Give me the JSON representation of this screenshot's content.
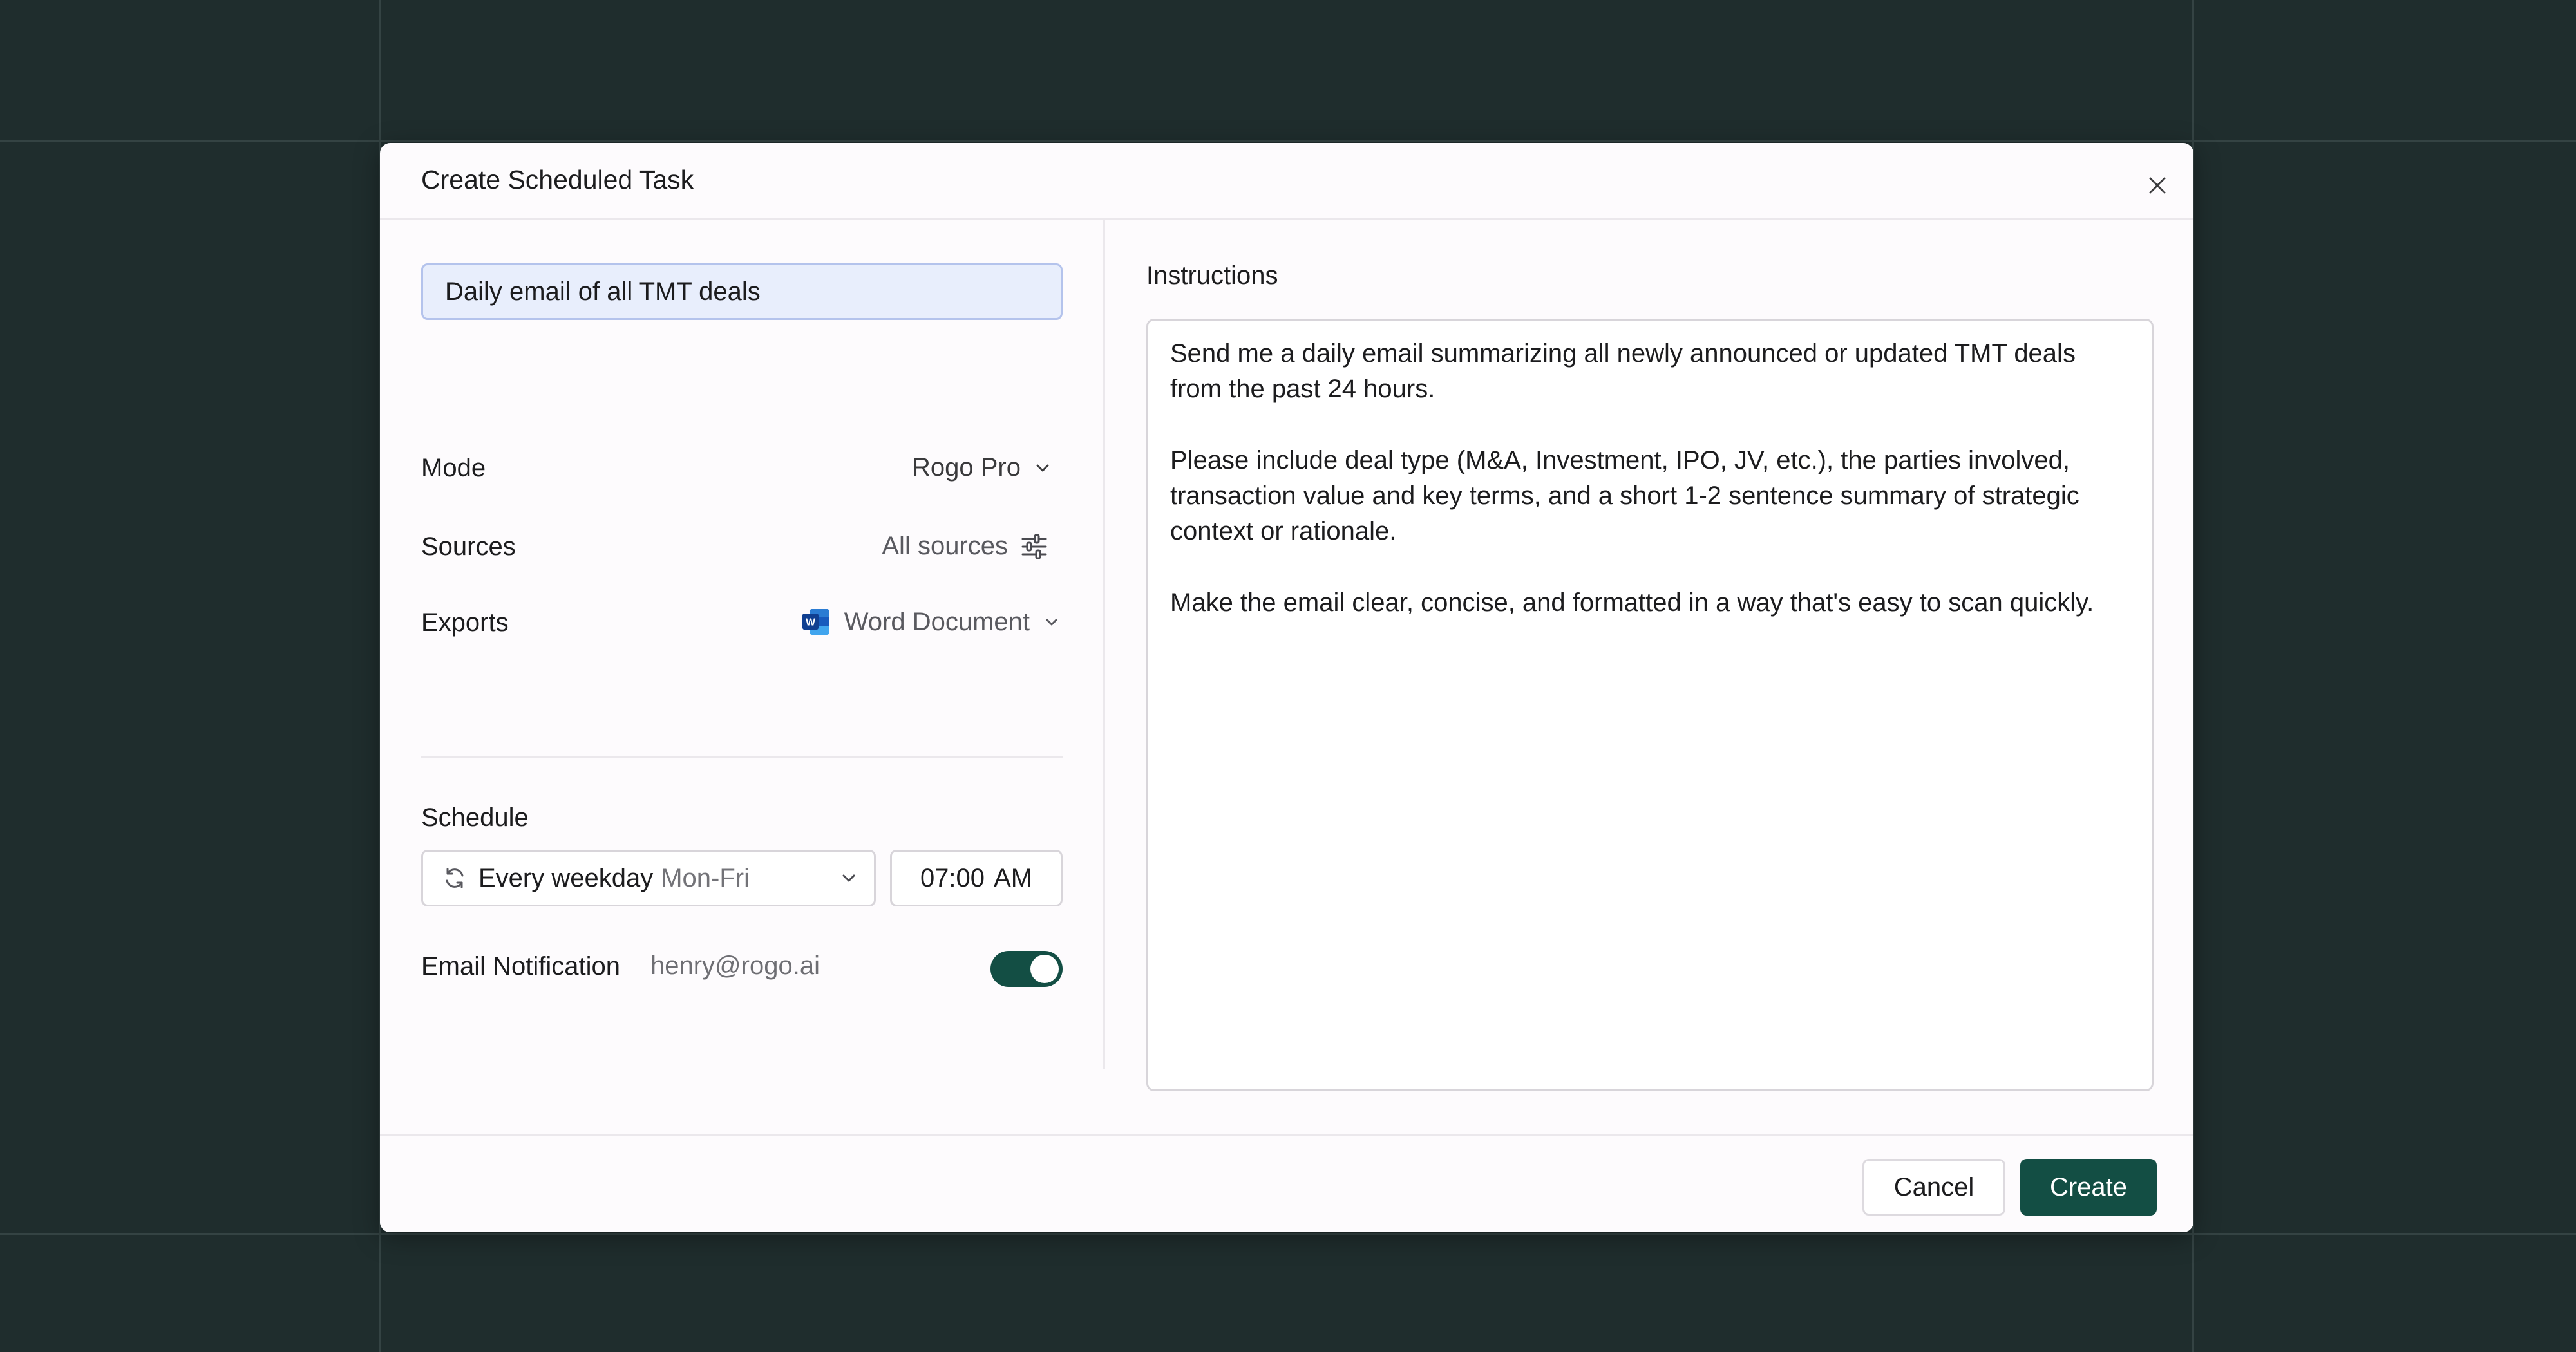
{
  "modal": {
    "title": "Create Scheduled Task"
  },
  "form": {
    "task_name": "Daily email of all TMT deals",
    "mode": {
      "label": "Mode",
      "value": "Rogo Pro"
    },
    "sources": {
      "label": "Sources",
      "value": "All sources"
    },
    "exports": {
      "label": "Exports",
      "value": "Word Document",
      "icon": "word-icon"
    },
    "schedule": {
      "label": "Schedule",
      "frequency": "Every weekday",
      "days": "Mon-Fri",
      "time": "07:00",
      "period": "AM"
    },
    "email_notification": {
      "label": "Email Notification",
      "email": "henry@rogo.ai",
      "enabled": true
    }
  },
  "instructions": {
    "label": "Instructions",
    "paragraphs": [
      "Send me a daily email summarizing all newly announced or updated TMT deals from the past 24 hours.",
      "Please include deal type (M&A, Investment, IPO, JV, etc.), the parties involved, transaction value and key terms, and a short 1-2 sentence summary of strategic context or rationale.",
      "Make the email clear, concise, and formatted in a way that's easy to scan quickly."
    ]
  },
  "footer": {
    "cancel_label": "Cancel",
    "create_label": "Create"
  },
  "colors": {
    "backdrop": "#1f2d2d",
    "accent": "#134e44",
    "input_highlight": "#e8eefc"
  }
}
